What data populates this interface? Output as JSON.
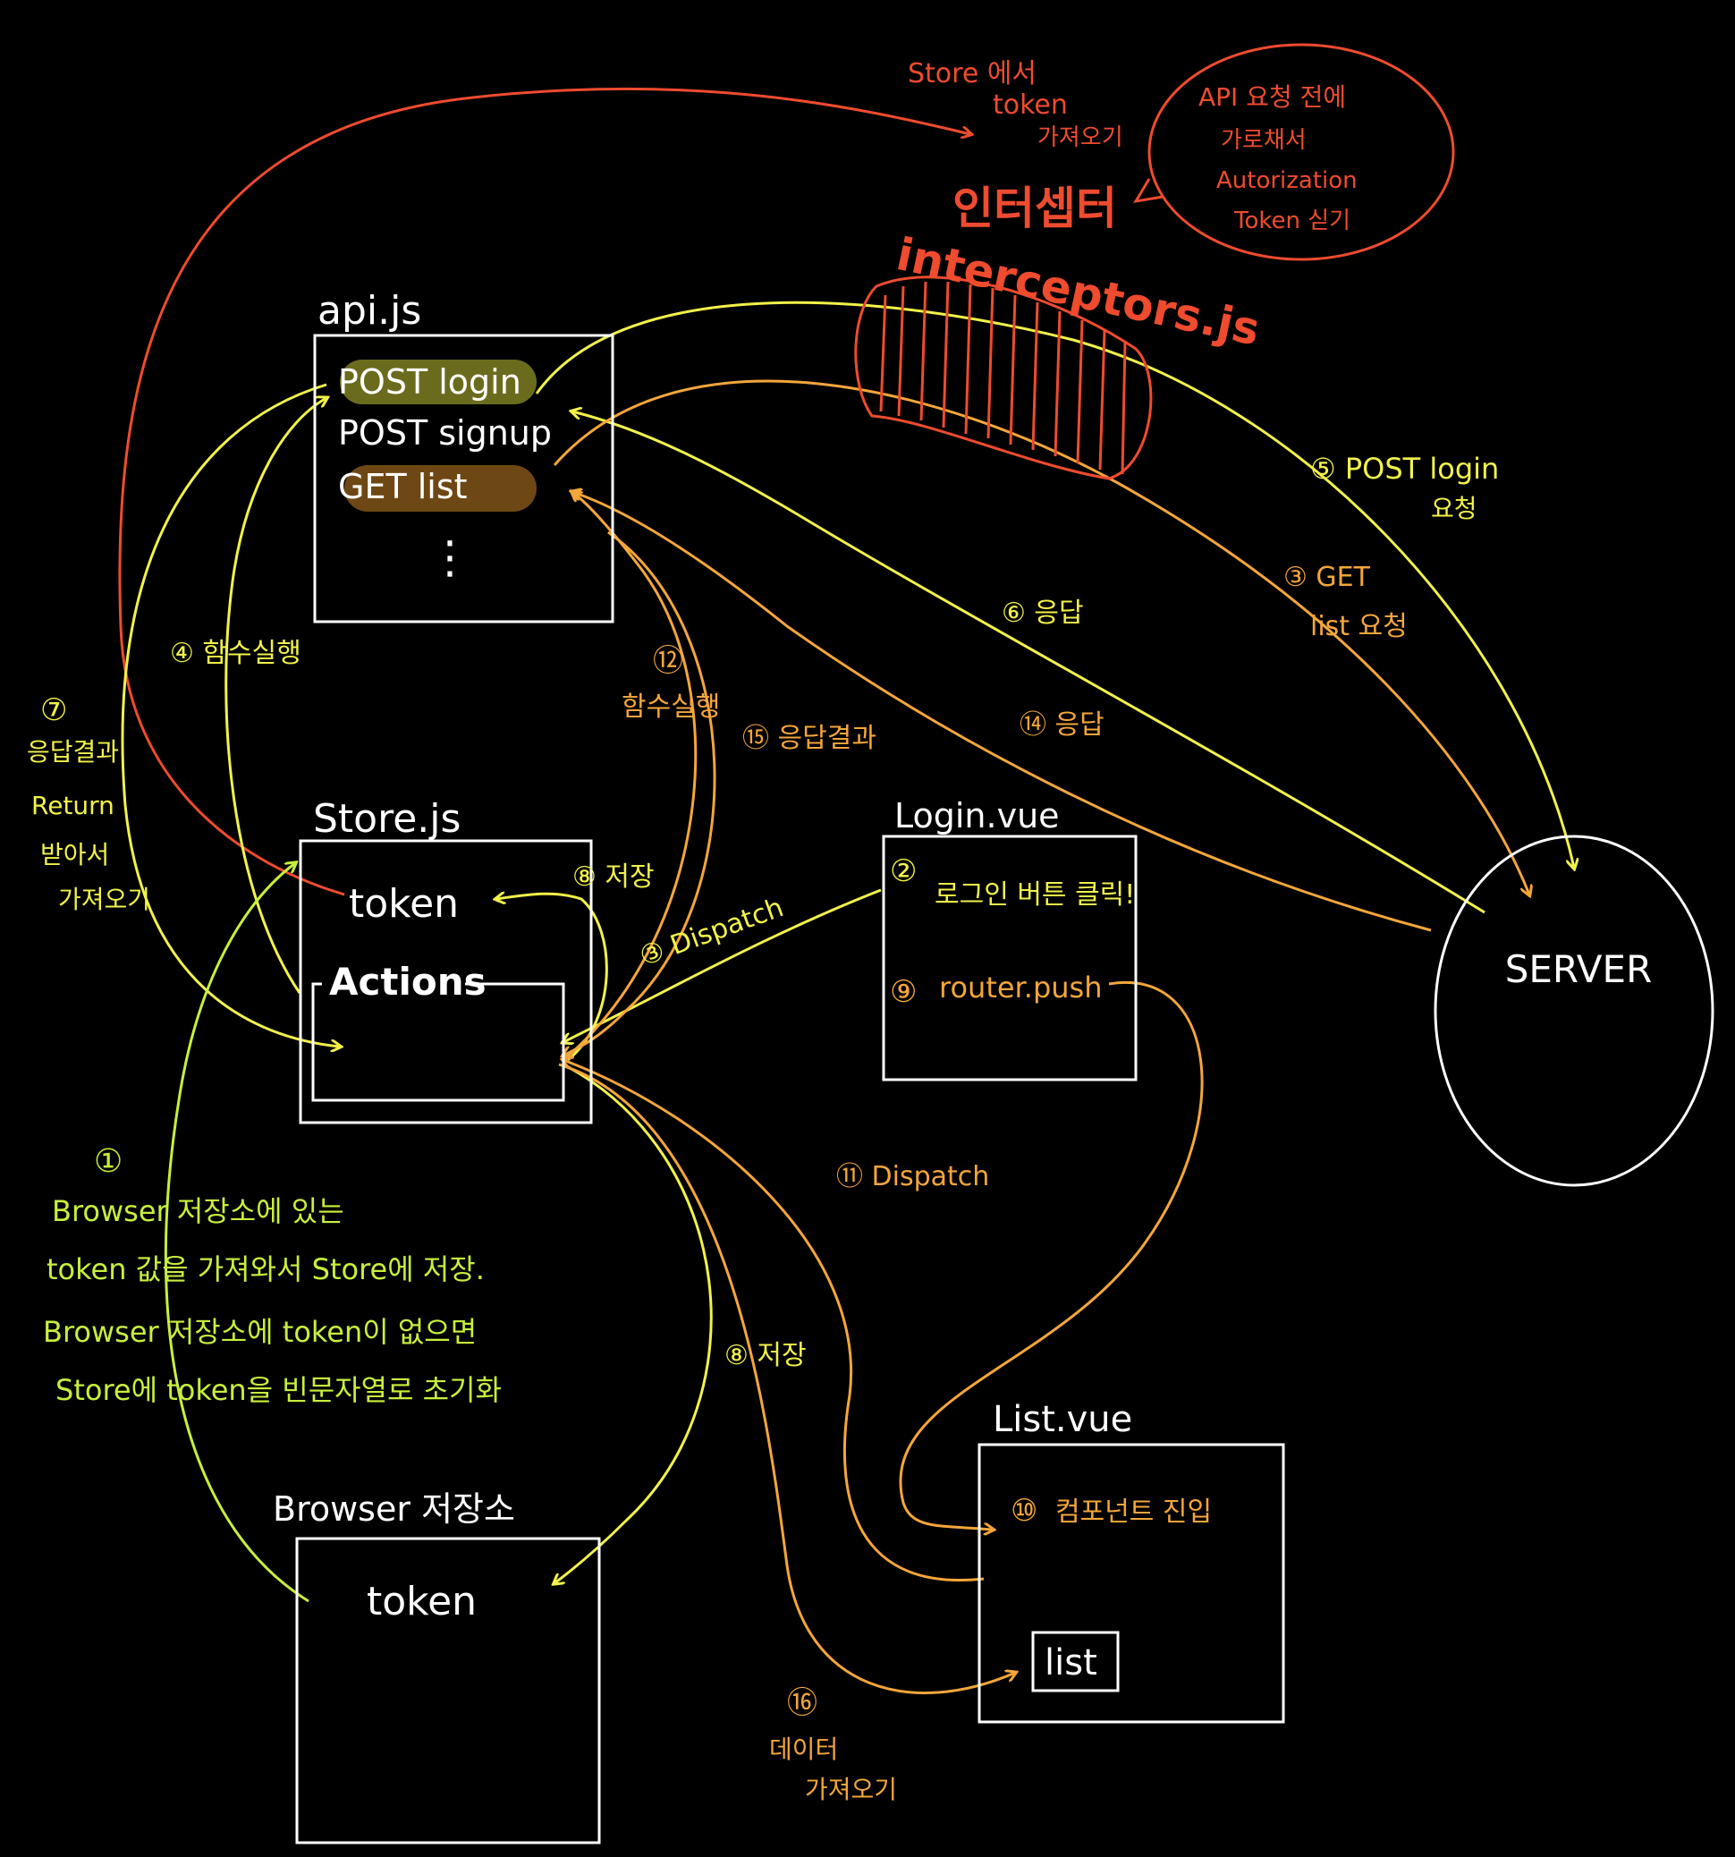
{
  "colors": {
    "background": "#000000",
    "box": "#ffffff",
    "yellow": "#f2f24a",
    "orange": "#f4a63a",
    "red": "#ef4b2f",
    "green": "#c8ef3c",
    "post_login_highlight": "#6b6b1e",
    "get_list_highlight": "#6e4814"
  },
  "api_js": {
    "title": "api.js",
    "items": [
      "POST login",
      "POST signup",
      "GET list"
    ],
    "ellipsis": "⋮"
  },
  "store_js": {
    "title": "Store.js",
    "token": "token",
    "actions": "Actions"
  },
  "login_vue": {
    "title": "Login.vue",
    "step2": "②",
    "step2_text": "로그인 버튼 클릭!",
    "step9": "⑨",
    "step9_text": "router.push"
  },
  "list_vue": {
    "title": "List.vue",
    "step10": "⑩",
    "step10_text": "컴포넌트 진입",
    "list_label": "list"
  },
  "browser_storage": {
    "title": "Browser 저장소",
    "token": "token"
  },
  "server": {
    "label": "SERVER"
  },
  "interceptors": {
    "title_ko": "인터셉터",
    "title_en": "interceptors.js",
    "note_top": [
      "Store 에서",
      "token",
      "가져오기"
    ],
    "bubble": [
      "API 요청 전에",
      "가로채서",
      "Autorization",
      "Token 싣기"
    ]
  },
  "steps": {
    "s1_num": "①",
    "s1_lines": [
      "Browser 저장소에 있는",
      "token 값을 가져와서 Store에 저장.",
      "Browser 저장소에 token이 없으면",
      "Store에 token을 빈문자열로 초기화"
    ],
    "s3_dispatch": "③ Dispatch",
    "s4": "④ 함수실행",
    "s5": [
      "⑤ POST login",
      "요청"
    ],
    "s6": "⑥ 응답",
    "s7_num": "⑦",
    "s7_lines": [
      "응답결과",
      "Return",
      "받아서",
      "가져오기"
    ],
    "s8_top": "⑧ 저장",
    "s8_bottom": "⑧ 저장",
    "s11": "⑪ Dispatch",
    "s12_num": "⑫",
    "s12_text": "함수실행",
    "s13": [
      "③ GET",
      "list 요청"
    ],
    "s14": "⑭ 응답",
    "s15": "⑮ 응답결과",
    "s16_num": "⑯",
    "s16_lines": [
      "데이터",
      "가져오기"
    ]
  }
}
